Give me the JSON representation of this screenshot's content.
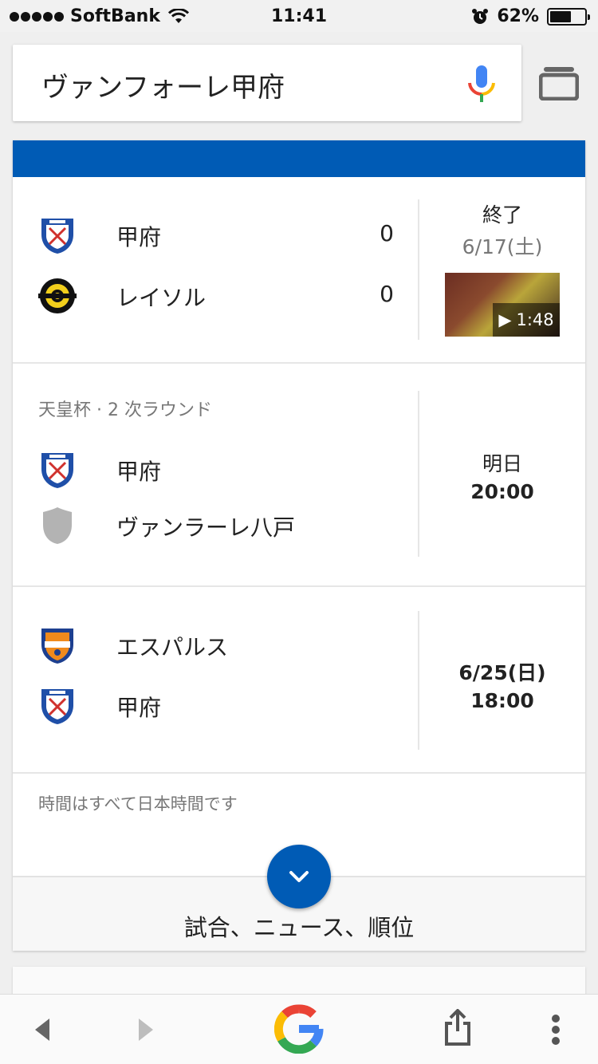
{
  "status_bar": {
    "carrier": "SoftBank",
    "time": "11:41",
    "battery_percent": "62%",
    "battery_level": 0.62
  },
  "search": {
    "query": "ヴァンフォーレ甲府"
  },
  "matches": [
    {
      "home": {
        "name": "甲府",
        "score": "0",
        "crest": "kofu-crest-icon"
      },
      "away": {
        "name": "レイソル",
        "score": "0",
        "crest": "reysol-crest-icon"
      },
      "status": "終了",
      "date": "6/17(土)",
      "video_duration": "1:48"
    },
    {
      "competition": "天皇杯 · 2 次ラウンド",
      "home": {
        "name": "甲府",
        "crest": "kofu-crest-icon"
      },
      "away": {
        "name": "ヴァンラーレ八戸",
        "crest": "generic-shield-icon"
      },
      "day": "明日",
      "time": "20:00"
    },
    {
      "home": {
        "name": "エスパルス",
        "crest": "spulse-crest-icon"
      },
      "away": {
        "name": "甲府",
        "crest": "kofu-crest-icon"
      },
      "date": "6/25(日)",
      "time": "18:00"
    }
  ],
  "footnote": "時間はすべて日本時間です",
  "more_label": "試合、ニュース、順位",
  "colors": {
    "accent_blue": "#005bb5",
    "background": "#efefef"
  }
}
